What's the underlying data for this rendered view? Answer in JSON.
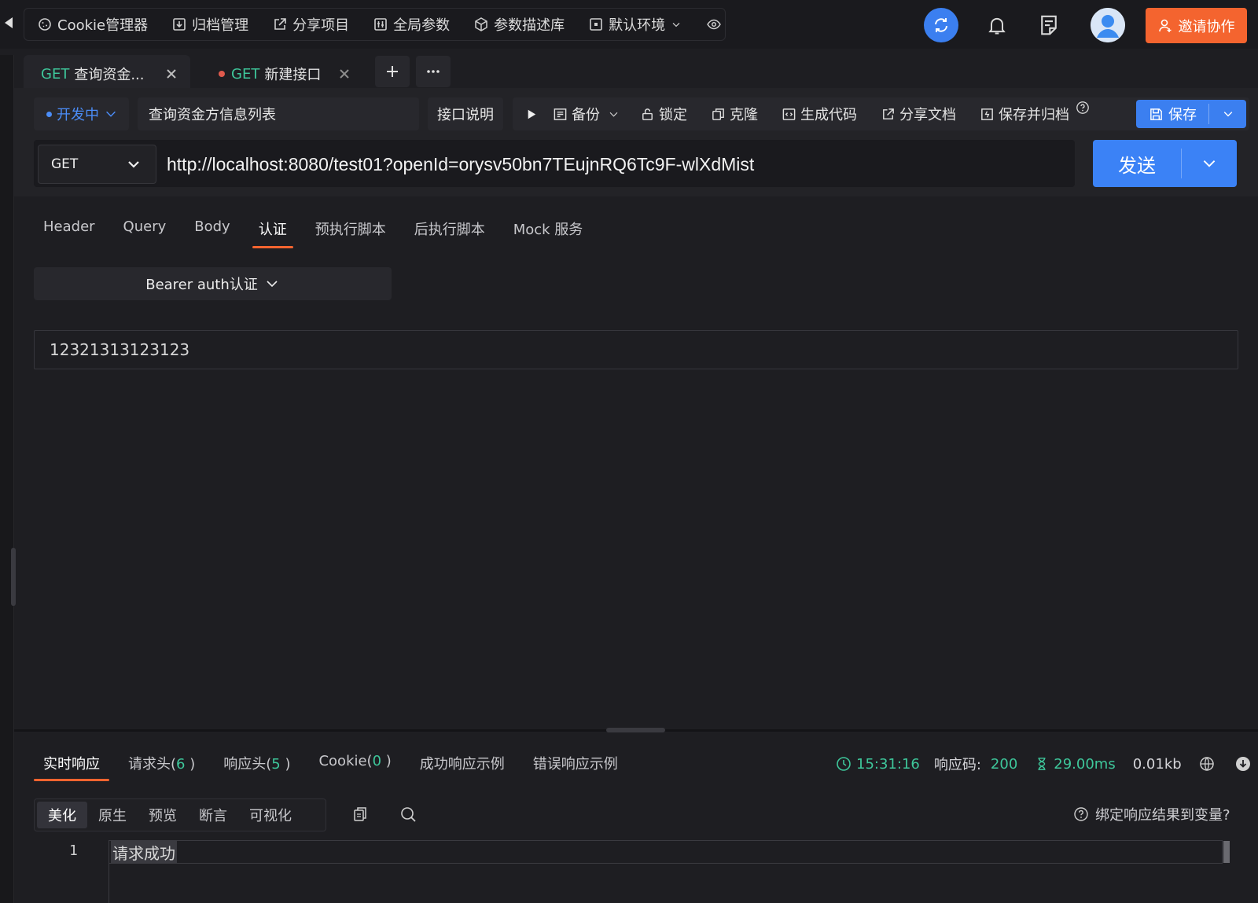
{
  "topbar": {
    "tools": [
      {
        "icon": "cookie-icon",
        "label": "Cookie管理器"
      },
      {
        "icon": "archive-icon",
        "label": "归档管理"
      },
      {
        "icon": "share-icon",
        "label": "分享项目"
      },
      {
        "icon": "global-params-icon",
        "label": "全局参数"
      },
      {
        "icon": "box-icon",
        "label": "参数描述库"
      },
      {
        "icon": "environment-icon",
        "label": "默认环境"
      }
    ],
    "invite_label": "邀请协作"
  },
  "tabs": [
    {
      "method": "GET",
      "title": "查询资金..."
    },
    {
      "method": "GET",
      "title": "新建接口"
    }
  ],
  "request": {
    "status": "开发中",
    "name": "查询资金方信息列表",
    "doc_button": "接口说明",
    "actions": {
      "backup": "备份",
      "lock": "锁定",
      "clone": "克隆",
      "gen_code": "生成代码",
      "share_doc": "分享文档",
      "save_archive": "保存并归档",
      "save": "保存"
    },
    "method": "GET",
    "url": "http://localhost:8080/test01?openId=orysv50bn7TEujnRQ6Tc9F-wlXdMist",
    "send": "发送"
  },
  "params": {
    "tabs": [
      "Header",
      "Query",
      "Body",
      "认证",
      "预执行脚本",
      "后执行脚本",
      "Mock 服务"
    ],
    "active_tab": "认证",
    "auth_type": "Bearer auth认证",
    "token": "12321313123123"
  },
  "response": {
    "tabs": {
      "live": "实时响应",
      "req_headers": "请求头(",
      "req_headers_count": "6",
      "resp_headers": "响应头(",
      "resp_headers_count": "5",
      "cookie": "Cookie(",
      "cookie_count": "0",
      "success_example": "成功响应示例",
      "error_example": "错误响应示例",
      "close_paren": " )"
    },
    "time": "15:31:16",
    "code_label": "响应码:",
    "code": "200",
    "duration": "29.00ms",
    "size": "0.01kb",
    "views": [
      "美化",
      "原生",
      "预览",
      "断言",
      "可视化"
    ],
    "active_view": "美化",
    "bind_label": "绑定响应结果到变量?",
    "line_number": "1",
    "body": "请求成功"
  },
  "colors": {
    "accent_blue": "#3b7ff0",
    "accent_orange": "#f4642f",
    "success_green": "#3ec79b"
  }
}
